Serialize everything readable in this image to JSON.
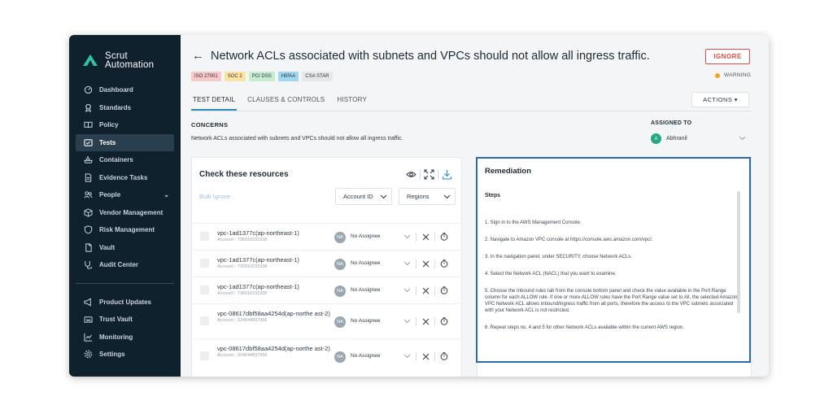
{
  "brand": {
    "name_line1": "Scrut",
    "name_line2": "Automation",
    "color": "#2fc4a1"
  },
  "sidebar": {
    "items": [
      {
        "label": "Dashboard",
        "icon": "dashboard-icon"
      },
      {
        "label": "Standards",
        "icon": "award-icon"
      },
      {
        "label": "Policy",
        "icon": "book-icon"
      },
      {
        "label": "Tests",
        "icon": "tests-icon",
        "active": true
      },
      {
        "label": "Containers",
        "icon": "container-icon"
      },
      {
        "label": "Evidence Tasks",
        "icon": "document-icon"
      },
      {
        "label": "People",
        "icon": "people-icon",
        "expandable": true
      },
      {
        "label": "Vendor Management",
        "icon": "box-icon"
      },
      {
        "label": "Risk Management",
        "icon": "shield-icon"
      },
      {
        "label": "Vault",
        "icon": "vault-icon"
      },
      {
        "label": "Audit Center",
        "icon": "audit-icon"
      }
    ],
    "bottom_items": [
      {
        "label": "Product Updates",
        "icon": "megaphone-icon"
      },
      {
        "label": "Trust Vault",
        "icon": "trust-icon"
      },
      {
        "label": "Monitoring",
        "icon": "chart-icon"
      },
      {
        "label": "Settings",
        "icon": "gear-icon"
      }
    ]
  },
  "header": {
    "title": "Network ACLs associated with subnets and VPCs should not allow all ingress traffic.",
    "ignore_label": "IGNORE",
    "severity": "WARNING",
    "severity_color": "#f2a51a",
    "tags": [
      {
        "label": "ISO 27001",
        "color": "#f7c9c9"
      },
      {
        "label": "SOC 2",
        "color": "#fbe3a2"
      },
      {
        "label": "PCI DSS",
        "color": "#c6ecd2"
      },
      {
        "label": "HIPAA",
        "color": "#9fd8f3"
      },
      {
        "label": "CSA STAR",
        "color": "#e6e8ea"
      }
    ],
    "tabs": [
      "TEST DETAIL",
      "CLAUSES & CONTROLS",
      "HISTORY"
    ],
    "actions_label": "ACTIONS ▾"
  },
  "concerns": {
    "heading": "CONCERNS",
    "text": "Network ACLs associated with subnets and VPCs should not allow all ingress traffic."
  },
  "assigned": {
    "heading": "ASSIGNED TO",
    "initial": "A",
    "name": "Abhranil"
  },
  "resources": {
    "title": "Check these resources",
    "bulk_ignore": "Bulk Ignore",
    "account_filter": "Account ID",
    "region_filter": "Regions",
    "rows": [
      {
        "name": "vpc-1ad1377c(ap-northeast-1)",
        "account": "Account - 736910231938",
        "assignee_initials": "NA",
        "assignee": "No Assignee"
      },
      {
        "name": "vpc-1ad1377c(ap-northeast-1)",
        "account": "Account - 736910231938",
        "assignee_initials": "NA",
        "assignee": "No Assignee"
      },
      {
        "name": "vpc-1ad1377c(ap-northeast-1)",
        "account": "Account - 736910231938",
        "assignee_initials": "NA",
        "assignee": "No Assignee"
      },
      {
        "name": "vpc-08617dbf58aa4254d(ap-northe ast-2)",
        "account": "Account - 324644837956",
        "assignee_initials": "NA",
        "assignee": "No Assignee"
      },
      {
        "name": "vpc-08617dbf58aa4254d(ap-northe ast-2)",
        "account": "Account - 324644837956",
        "assignee_initials": "NA",
        "assignee": "No Assignee"
      }
    ]
  },
  "remediation": {
    "title": "Remediation",
    "steps_heading": "Steps",
    "steps": [
      "1. Sign in to the AWS Management Console.",
      "2. Navigate to Amazon VPC console at https://console.aws.amazon.com/vpc/.",
      "3. In the navigation panel, under SECURITY, choose Network ACLs.",
      "4. Select the Network ACL (NACL) that you want to examine.",
      "5. Choose the Inbound rules tab from the console bottom panel and check the value available in the Port Range column for each ALLOW rule. If one or more ALLOW rules have the Port Range value set to All, the selected Amazon VPC Network ACL allows inbound/ingress traffic from all ports, therefore the access to the VPC subnets associated with your Network ACL is not restricted.",
      "6. Repeat steps no. 4 and 5 for other Network ACLs available within the current AWS region."
    ]
  }
}
